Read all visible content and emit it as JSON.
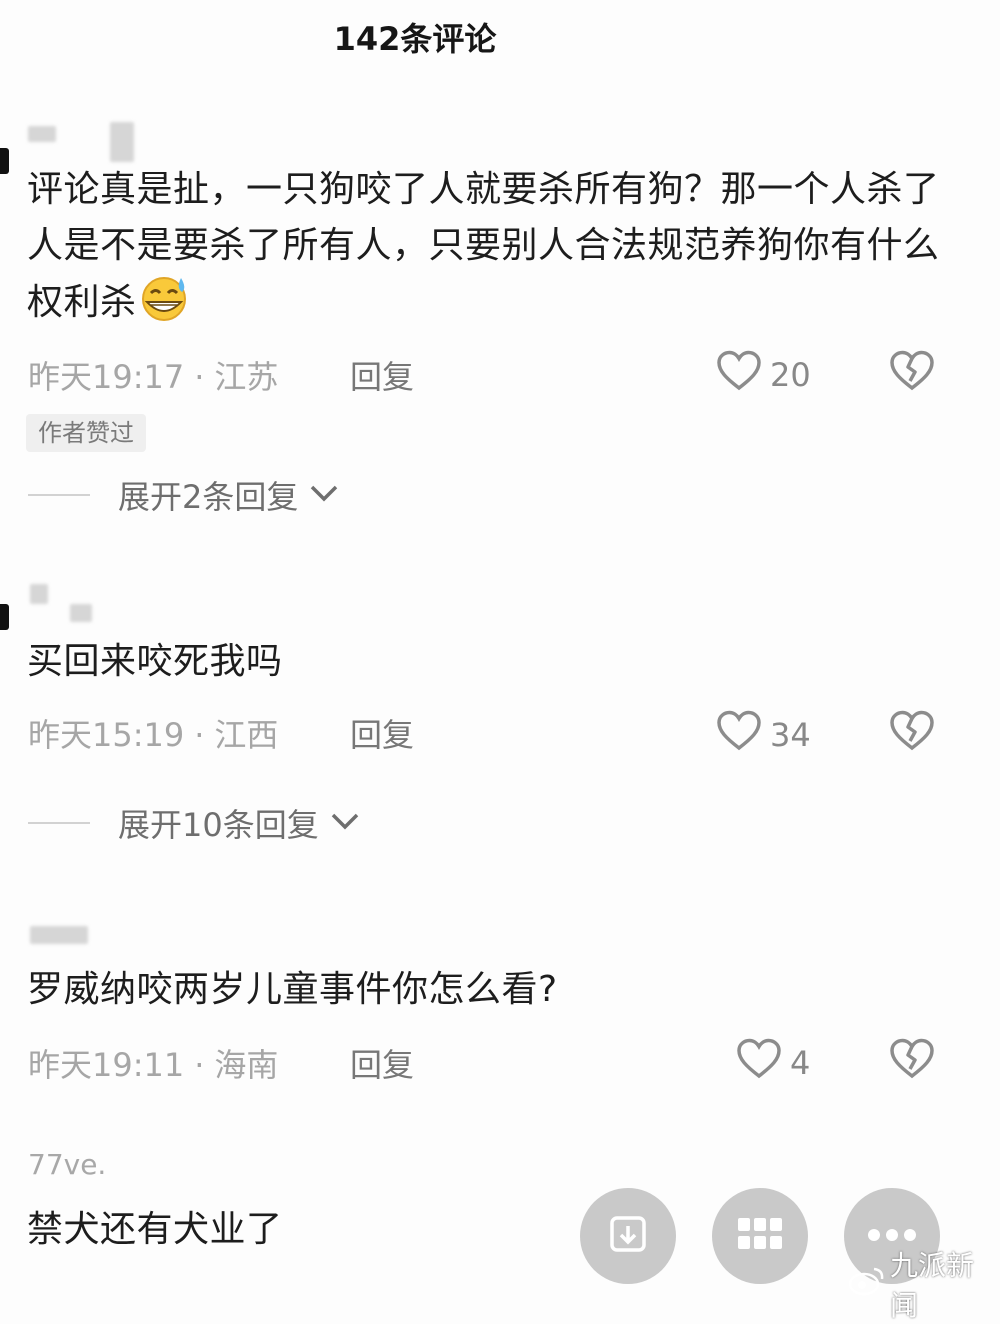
{
  "header": {
    "title": "142条评论"
  },
  "comments": [
    {
      "username": "",
      "text": "评论真是扯，一只狗咬了人就要杀所有狗？那一个人杀了人是不是要杀了所有人，只要别人合法规范养狗你有什么权利杀",
      "time": "昨天19:17",
      "location": "江苏",
      "reply_label": "回复",
      "likes": "20",
      "badge": "作者赞过",
      "expand_label": "展开2条回复",
      "emoji": "grinning-sweat-emoji"
    },
    {
      "username": "",
      "text": "买回来咬死我吗",
      "time": "昨天15:19",
      "location": "江西",
      "reply_label": "回复",
      "likes": "34",
      "expand_label": "展开10条回复"
    },
    {
      "username": "",
      "text": "罗威纳咬两岁儿童事件你怎么看?",
      "time": "昨天19:11",
      "location": "海南",
      "reply_label": "回复",
      "likes": "4"
    },
    {
      "username": "77ve.",
      "text": "禁犬还有犬业了"
    }
  ],
  "separator": "·",
  "icons": {
    "like": "heart-outline-icon",
    "dislike": "broken-heart-icon",
    "expand": "chevron-down-icon",
    "fab_1": "download-icon",
    "fab_2": "grid-icon",
    "fab_3": "more-icon"
  },
  "watermark": {
    "text": "九派新闻",
    "icon": "weibo-icon"
  },
  "colors": {
    "muted": "#a6a6a6",
    "fab": "#c9c9c9"
  }
}
